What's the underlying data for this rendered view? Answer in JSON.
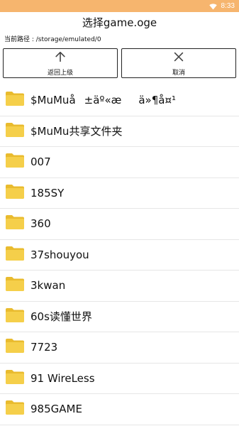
{
  "status": {
    "time": "8:33",
    "wifi_icon": "wifi-icon"
  },
  "header": {
    "title": "选择game.oge"
  },
  "path": {
    "label": "当前路径 : /storage/emulated/0"
  },
  "buttons": {
    "up": {
      "label": "返回上级",
      "icon": "arrow-up-icon"
    },
    "cancel": {
      "label": "取消",
      "icon": "close-icon"
    }
  },
  "folders": [
    "$MuMuå±äº«æä»¶å¤¹",
    "$MuMu共享文件夹",
    "007",
    "185SY",
    "360",
    "37shouyou",
    "3kwan",
    "60s读懂世界",
    "7723",
    "91 WireLess",
    "985GAME"
  ],
  "colors": {
    "status_bar": "#f6b56e",
    "folder": "#f5cf4a"
  }
}
